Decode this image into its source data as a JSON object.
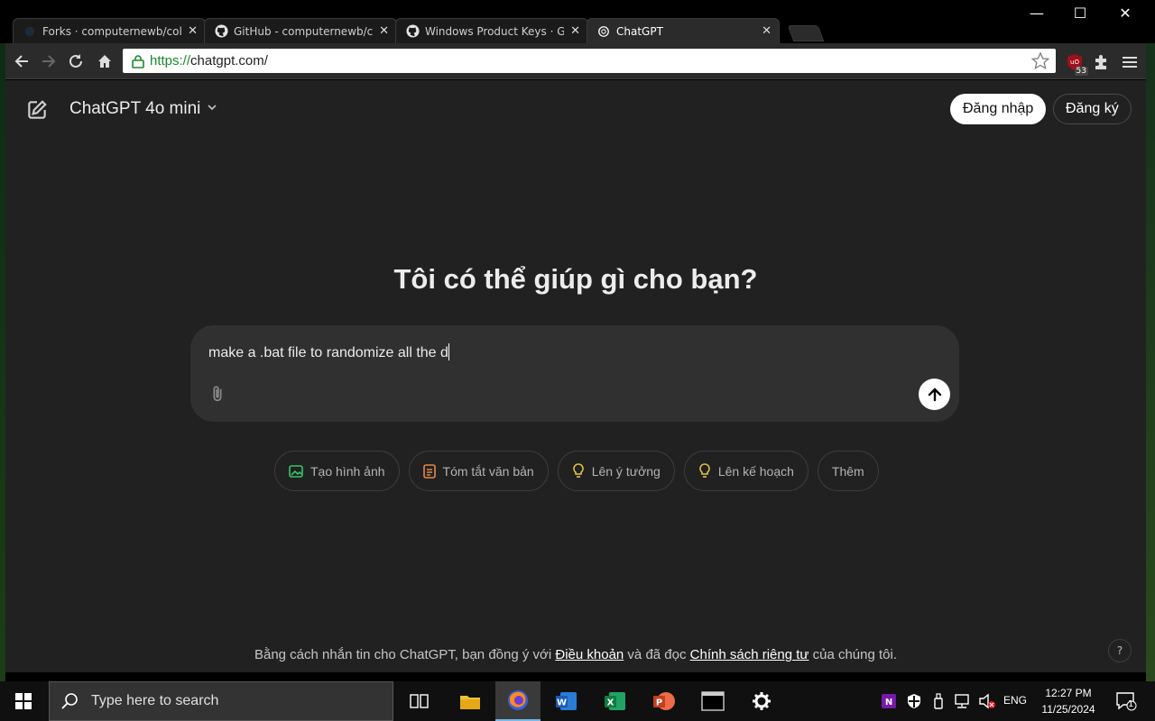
{
  "window": {
    "controls": {
      "minimize": "—",
      "maximize": "☐",
      "close": "✕"
    }
  },
  "tabs": [
    {
      "title": "Forks · computernewb/colla",
      "icon": "forks-icon",
      "active": false
    },
    {
      "title": "GitHub - computernewb/co",
      "icon": "github-icon",
      "active": false
    },
    {
      "title": "Windows Product Keys · Gi",
      "icon": "github-icon",
      "active": false
    },
    {
      "title": "ChatGPT",
      "icon": "openai-icon",
      "active": true
    }
  ],
  "toolbar": {
    "url_scheme": "https://",
    "url_rest": "chatgpt.com/",
    "ublock_count": "53"
  },
  "page": {
    "model_name": "ChatGPT 4o mini",
    "login_label": "Đăng nhập",
    "signup_label": "Đăng ký",
    "headline": "Tôi có thể giúp gì cho bạn?",
    "composer_text": "make a .bat file to randomize all the d",
    "chips": [
      {
        "label": "Tạo hình ảnh",
        "icon": "image-icon",
        "color": "#35c46a"
      },
      {
        "label": "Tóm tắt văn bản",
        "icon": "document-icon",
        "color": "#e2894a"
      },
      {
        "label": "Lên ý tưởng",
        "icon": "lightbulb-icon",
        "color": "#e2c541"
      },
      {
        "label": "Lên kế hoạch",
        "icon": "lightbulb-icon",
        "color": "#e2c541"
      },
      {
        "label": "Thêm",
        "icon": "",
        "color": ""
      }
    ],
    "footer_pre": "Bằng cách nhắn tin cho ChatGPT, bạn đồng ý với ",
    "footer_terms": "Điều khoản",
    "footer_mid": " và đã đọc ",
    "footer_privacy": "Chính sách riêng tư",
    "footer_post": " của chúng tôi.",
    "help": "?"
  },
  "taskbar": {
    "search_placeholder": "Type here to search",
    "language": "ENG",
    "time": "12:27 PM",
    "date": "11/25/2024",
    "notification_count": "1"
  }
}
